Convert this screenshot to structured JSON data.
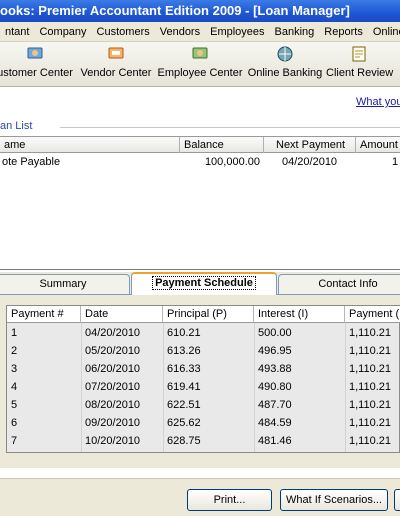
{
  "window": {
    "title": "ooks: Premier Accountant Edition 2009 - [Loan Manager]"
  },
  "menu": [
    "ntant",
    "Company",
    "Customers",
    "Vendors",
    "Employees",
    "Banking",
    "Reports",
    "Online Ser"
  ],
  "iconbar": [
    {
      "label": "ustomer Center",
      "icon": "customer-center-icon"
    },
    {
      "label": "Vendor Center",
      "icon": "vendor-center-icon"
    },
    {
      "label": "Employee Center",
      "icon": "employee-center-icon"
    },
    {
      "label": "Online Banking",
      "icon": "online-banking-icon"
    },
    {
      "label": "Client Review",
      "icon": "client-review-icon"
    }
  ],
  "what_link": "What you",
  "loan_list": {
    "title": "an List",
    "columns": [
      "ame",
      "Balance",
      "Next Payment",
      "Amount"
    ],
    "rows": [
      {
        "name": "ote Payable",
        "balance": "100,000.00",
        "next_payment": "04/20/2010",
        "amount": "1"
      }
    ]
  },
  "tabs": [
    {
      "label": "Summary",
      "active": false
    },
    {
      "label": "Payment Schedule",
      "active": true
    },
    {
      "label": "Contact Info",
      "active": false
    }
  ],
  "schedule": {
    "columns": [
      "Payment #",
      "Date",
      "Principal (P)",
      "Interest (I)",
      "Payment (P"
    ],
    "rows": [
      {
        "num": "1",
        "date": "04/20/2010",
        "principal": "610.21",
        "interest": "500.00",
        "payment": "1,110.21"
      },
      {
        "num": "2",
        "date": "05/20/2010",
        "principal": "613.26",
        "interest": "496.95",
        "payment": "1,110.21"
      },
      {
        "num": "3",
        "date": "06/20/2010",
        "principal": "616.33",
        "interest": "493.88",
        "payment": "1,110.21"
      },
      {
        "num": "4",
        "date": "07/20/2010",
        "principal": "619.41",
        "interest": "490.80",
        "payment": "1,110.21"
      },
      {
        "num": "5",
        "date": "08/20/2010",
        "principal": "622.51",
        "interest": "487.70",
        "payment": "1,110.21"
      },
      {
        "num": "6",
        "date": "09/20/2010",
        "principal": "625.62",
        "interest": "484.59",
        "payment": "1,110.21"
      },
      {
        "num": "7",
        "date": "10/20/2010",
        "principal": "628.75",
        "interest": "481.46",
        "payment": "1,110.21"
      }
    ]
  },
  "buttons": {
    "print": "Print...",
    "what_if": "What If Scenarios..."
  },
  "colors": {
    "titlebar": "#1f56d4",
    "link": "#1a1aa8",
    "active_tab_accent": "#f0a030"
  }
}
